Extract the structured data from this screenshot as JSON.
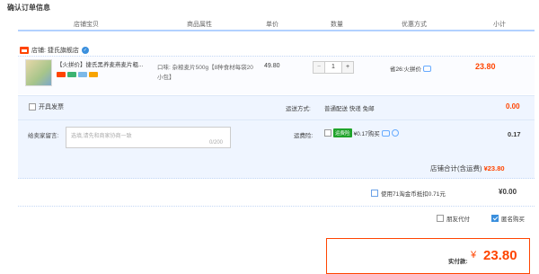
{
  "page": {
    "title": "确认订单信息"
  },
  "columns": {
    "item": "店铺宝贝",
    "attr": "商品属性",
    "price": "单价",
    "qty": "数量",
    "discount": "优惠方式",
    "subtotal": "小计"
  },
  "shop": {
    "label": "店铺: 捷氏旗舰店"
  },
  "item": {
    "title": "【火拼价】捷氏黑养麦燕麦片粗...",
    "attr": "口味: 杂粮麦片500g【8种食材每袋20小包】",
    "price": "49.80",
    "qty": "1",
    "minus": "−",
    "plus": "+",
    "discount": "省26:火拼价",
    "subtotal": "23.80"
  },
  "options": {
    "invoice_label": "开具发票",
    "ship_label": "运送方式:",
    "ship_value": "普通配送 快递 免邮",
    "ship_cost": "0.00",
    "msg_label": "给卖家留言:",
    "msg_placeholder": "选填,请先和商家协商一致",
    "msg_count": "0/200",
    "ins_label": "运费险:",
    "ins_badge": "运费险",
    "ins_text": "¥0.17购买",
    "ins_cost": "0.17"
  },
  "totals": {
    "shop_total_label": "店铺合计(含运费)",
    "shop_total_value": "¥23.80",
    "coin_label": "使用71淘金币抵扣0.71元",
    "coin_value": "¥0.00",
    "friend_pay": "朋友代付",
    "anon_buy": "匿名购买",
    "pay_label": "实付款:",
    "pay_currency": "¥",
    "pay_value": "23.80"
  },
  "colors": {
    "accent": "#ff4400",
    "blue": "#3a8fdd"
  }
}
